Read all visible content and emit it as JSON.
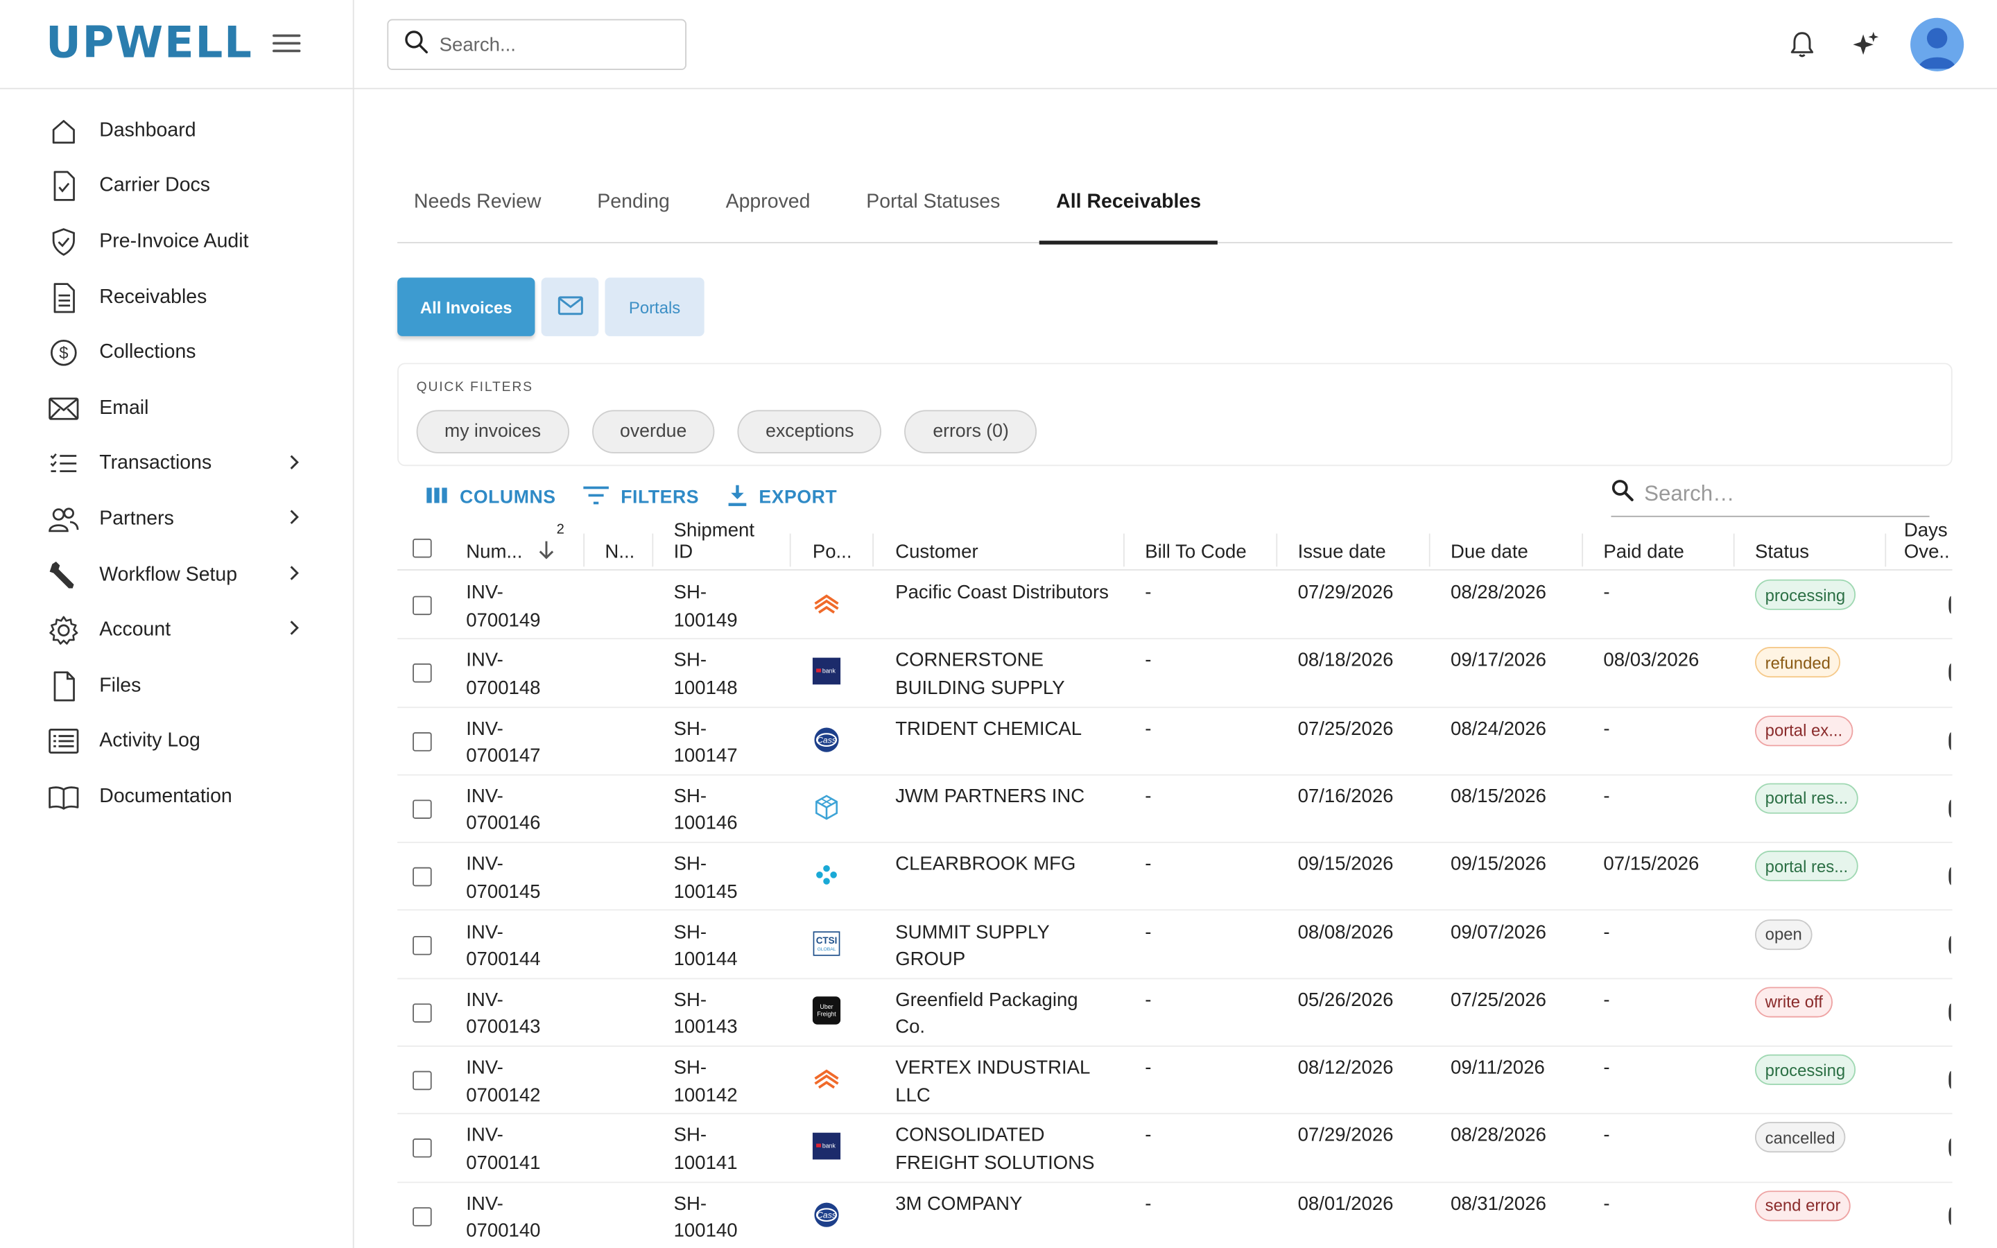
{
  "app": {
    "logo_text": "UPWELL",
    "search_placeholder": "Search..."
  },
  "sidebar": {
    "items": [
      {
        "label": "Dashboard",
        "icon": "home-icon",
        "has_chevron": false
      },
      {
        "label": "Carrier Docs",
        "icon": "document-check-icon",
        "has_chevron": false
      },
      {
        "label": "Pre-Invoice Audit",
        "icon": "shield-check-icon",
        "has_chevron": false
      },
      {
        "label": "Receivables",
        "icon": "receipt-icon",
        "has_chevron": false
      },
      {
        "label": "Collections",
        "icon": "dollar-circle-icon",
        "has_chevron": false
      },
      {
        "label": "Email",
        "icon": "envelope-icon",
        "has_chevron": false
      },
      {
        "label": "Transactions",
        "icon": "list-icon",
        "has_chevron": true
      },
      {
        "label": "Partners",
        "icon": "people-icon",
        "has_chevron": true
      },
      {
        "label": "Workflow Setup",
        "icon": "wrench-icon",
        "has_chevron": true
      },
      {
        "label": "Account",
        "icon": "gear-icon",
        "has_chevron": true
      },
      {
        "label": "Files",
        "icon": "file-icon",
        "has_chevron": false
      },
      {
        "label": "Activity Log",
        "icon": "log-icon",
        "has_chevron": false
      },
      {
        "label": "Documentation",
        "icon": "book-icon",
        "has_chevron": false
      }
    ]
  },
  "tabs": [
    {
      "label": "Needs Review",
      "active": false
    },
    {
      "label": "Pending",
      "active": false
    },
    {
      "label": "Approved",
      "active": false
    },
    {
      "label": "Portal Statuses",
      "active": false
    },
    {
      "label": "All Receivables",
      "active": true
    }
  ],
  "subtabs": {
    "all_invoices": "All Invoices",
    "portals": "Portals"
  },
  "quick_filters": {
    "title": "QUICK FILTERS",
    "chips": [
      "my invoices",
      "overdue",
      "exceptions",
      "errors (0)"
    ]
  },
  "toolbar": {
    "columns": "COLUMNS",
    "filters": "FILTERS",
    "export": "EXPORT",
    "search_placeholder": "Search…"
  },
  "table": {
    "headers": {
      "number": "Num...",
      "sort_index": "2",
      "n": "N...",
      "shipment": "Shipment ID",
      "portal": "Po...",
      "customer": "Customer",
      "bill_to": "Bill To Code",
      "issue": "Issue date",
      "due": "Due date",
      "paid": "Paid date",
      "status": "Status",
      "days": "Days Ove.."
    },
    "rows": [
      {
        "number": "INV-0700149",
        "shipment": "SH-100149",
        "portal": "orange-chevron",
        "customer": "Pacific Coast Distributors",
        "bill_to": "-",
        "issue": "07/29/2026",
        "due": "08/28/2026",
        "paid": "-",
        "status": "processing",
        "status_color": "green"
      },
      {
        "number": "INV-0700148",
        "shipment": "SH-100148",
        "portal": "usbank",
        "customer": "CORNERSTONE BUILDING SUPPLY",
        "bill_to": "-",
        "issue": "08/18/2026",
        "due": "09/17/2026",
        "paid": "08/03/2026",
        "status": "refunded",
        "status_color": "orange"
      },
      {
        "number": "INV-0700147",
        "shipment": "SH-100147",
        "portal": "cass",
        "customer": "TRIDENT CHEMICAL",
        "bill_to": "-",
        "issue": "07/25/2026",
        "due": "08/24/2026",
        "paid": "-",
        "status": "portal ex...",
        "status_color": "red"
      },
      {
        "number": "INV-0700146",
        "shipment": "SH-100146",
        "portal": "cube",
        "customer": "JWM PARTNERS INC",
        "bill_to": "-",
        "issue": "07/16/2026",
        "due": "08/15/2026",
        "paid": "-",
        "status": "portal res...",
        "status_color": "green"
      },
      {
        "number": "INV-0700145",
        "shipment": "SH-100145",
        "portal": "dots",
        "customer": "CLEARBROOK MFG",
        "bill_to": "-",
        "issue": "09/15/2026",
        "due": "09/15/2026",
        "paid": "07/15/2026",
        "status": "portal res...",
        "status_color": "green"
      },
      {
        "number": "INV-0700144",
        "shipment": "SH-100144",
        "portal": "ctsi",
        "customer": "SUMMIT SUPPLY GROUP",
        "bill_to": "-",
        "issue": "08/08/2026",
        "due": "09/07/2026",
        "paid": "-",
        "status": "open",
        "status_color": "gray"
      },
      {
        "number": "INV-0700143",
        "shipment": "SH-100143",
        "portal": "uber",
        "customer": "Greenfield Packaging Co.",
        "bill_to": "-",
        "issue": "05/26/2026",
        "due": "07/25/2026",
        "paid": "-",
        "status": "write off",
        "status_color": "red"
      },
      {
        "number": "INV-0700142",
        "shipment": "SH-100142",
        "portal": "orange-chevron",
        "customer": "VERTEX INDUSTRIAL LLC",
        "bill_to": "-",
        "issue": "08/12/2026",
        "due": "09/11/2026",
        "paid": "-",
        "status": "processing",
        "status_color": "green"
      },
      {
        "number": "INV-0700141",
        "shipment": "SH-100141",
        "portal": "usbank",
        "customer": "CONSOLIDATED FREIGHT SOLUTIONS",
        "bill_to": "-",
        "issue": "07/29/2026",
        "due": "08/28/2026",
        "paid": "-",
        "status": "cancelled",
        "status_color": "gray"
      },
      {
        "number": "INV-0700140",
        "shipment": "SH-100140",
        "portal": "cass",
        "customer": "3M COMPANY",
        "bill_to": "-",
        "issue": "08/01/2026",
        "due": "08/31/2026",
        "paid": "-",
        "status": "send error",
        "status_color": "red"
      }
    ]
  },
  "colors": {
    "brand": "#2a7dae",
    "accent": "#3d9bd0",
    "status_green_bg": "#e6f5ec",
    "status_green_border": "#9fd8b2",
    "status_orange_bg": "#fff4e3",
    "status_orange_border": "#f5c98a",
    "status_red_bg": "#fdecec",
    "status_red_border": "#eea3a3",
    "status_gray_bg": "#f3f3f3",
    "status_gray_border": "#c9c9c9"
  }
}
